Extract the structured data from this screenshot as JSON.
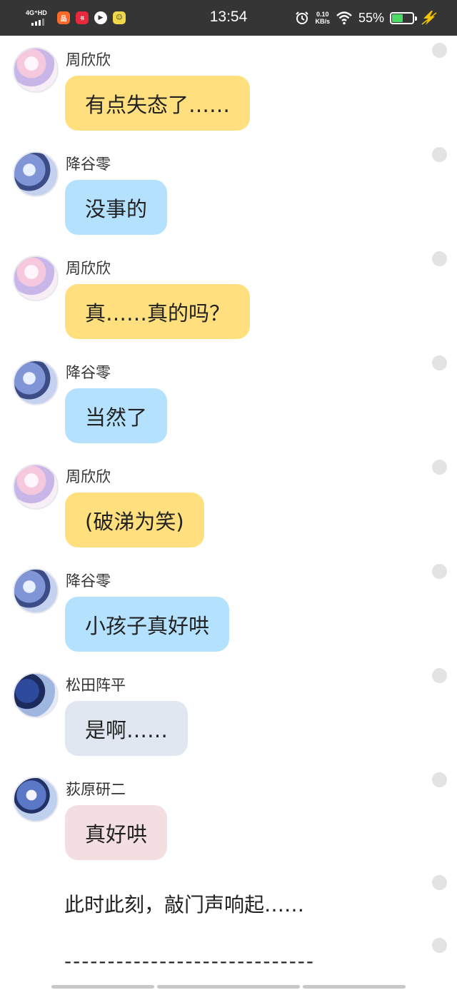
{
  "status_bar": {
    "network_label": "4G⁺HD",
    "app_icons": [
      {
        "name": "orange-app-icon",
        "color": "#ff6a2a",
        "glyph": "品"
      },
      {
        "name": "red-app-icon",
        "color": "#e8283c",
        "glyph": "小红书"
      },
      {
        "name": "play-app-icon",
        "color": "#ffffff",
        "glyph": "▶"
      },
      {
        "name": "yellow-app-icon",
        "color": "#f0d84a",
        "glyph": "☺"
      }
    ],
    "time": "13:54",
    "speed_value": "0.10",
    "speed_unit": "KB/s",
    "battery_percent": "55%",
    "battery_level": 0.55,
    "battery_color": "#4cd964",
    "charge_color": "#f2c500"
  },
  "messages": [
    {
      "sender": "周欣欣",
      "text": "有点失态了……",
      "bubble_color": "#ffdf7e",
      "avatar": "pink-anime-girl-avatar"
    },
    {
      "sender": "降谷零",
      "text": "没事的",
      "bubble_color": "#b4e2fe",
      "avatar": "blue-anime-duo-avatar"
    },
    {
      "sender": "周欣欣",
      "text": "真……真的吗？",
      "bubble_color": "#ffdf7e",
      "avatar": "pink-anime-girl-avatar"
    },
    {
      "sender": "降谷零",
      "text": "当然了",
      "bubble_color": "#b4e2fe",
      "avatar": "blue-anime-duo-avatar"
    },
    {
      "sender": "周欣欣",
      "text": "(破涕为笑)",
      "bubble_color": "#ffdf7e",
      "avatar": "pink-anime-girl-avatar"
    },
    {
      "sender": "降谷零",
      "text": "小孩子真好哄",
      "bubble_color": "#b4e2fe",
      "avatar": "blue-anime-duo-avatar"
    },
    {
      "sender": "松田阵平",
      "text": "是啊……",
      "bubble_color": "#e0e7f1",
      "avatar": "navy-anime-duo-avatar"
    },
    {
      "sender": "荻原研二",
      "text": "真好哄",
      "bubble_color": "#f3dfe1",
      "avatar": "sky-anime-duo-avatar"
    }
  ],
  "narration": "此时此刻，敲门声响起……",
  "divider": "-----------------------------"
}
